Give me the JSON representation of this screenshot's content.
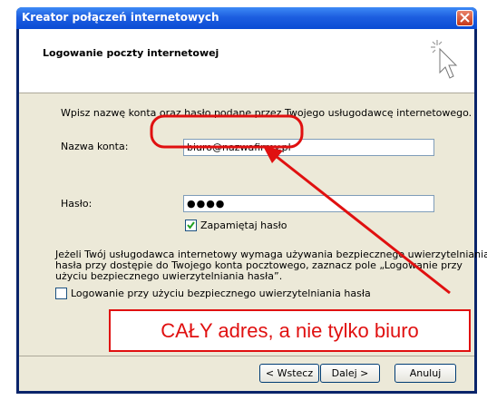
{
  "window": {
    "title": "Kreator połączeń internetowych"
  },
  "header": {
    "title": "Logowanie poczty internetowej"
  },
  "instructions": "Wpisz nazwę konta oraz hasło podane przez Twojego usługodawcę internetowego.",
  "account": {
    "label": "Nazwa konta:",
    "value": "biuro@nazwafirmy.pl"
  },
  "password": {
    "label": "Hasło:",
    "value": "●●●●"
  },
  "remember": {
    "label": "Zapamiętaj hasło",
    "checked": true
  },
  "spa": {
    "description": [
      "Jeżeli Twój usługodawca internetowy wymaga używania bezpiecznego uwierzytelniania",
      "hasła przy dostępie do Twojego konta pocztowego, zaznacz pole „Logowanie przy",
      "użyciu bezpiecznego uwierzytelniania hasła”."
    ],
    "checkbox_label": "Logowanie przy użyciu bezpiecznego uwierzytelniania hasła",
    "checked": false
  },
  "buttons": {
    "back": "< Wstecz",
    "next": "Dalej >",
    "cancel": "Anuluj"
  },
  "annotation": {
    "text": "CAŁY adres, a nie tylko biuro",
    "color": "#e01010"
  }
}
